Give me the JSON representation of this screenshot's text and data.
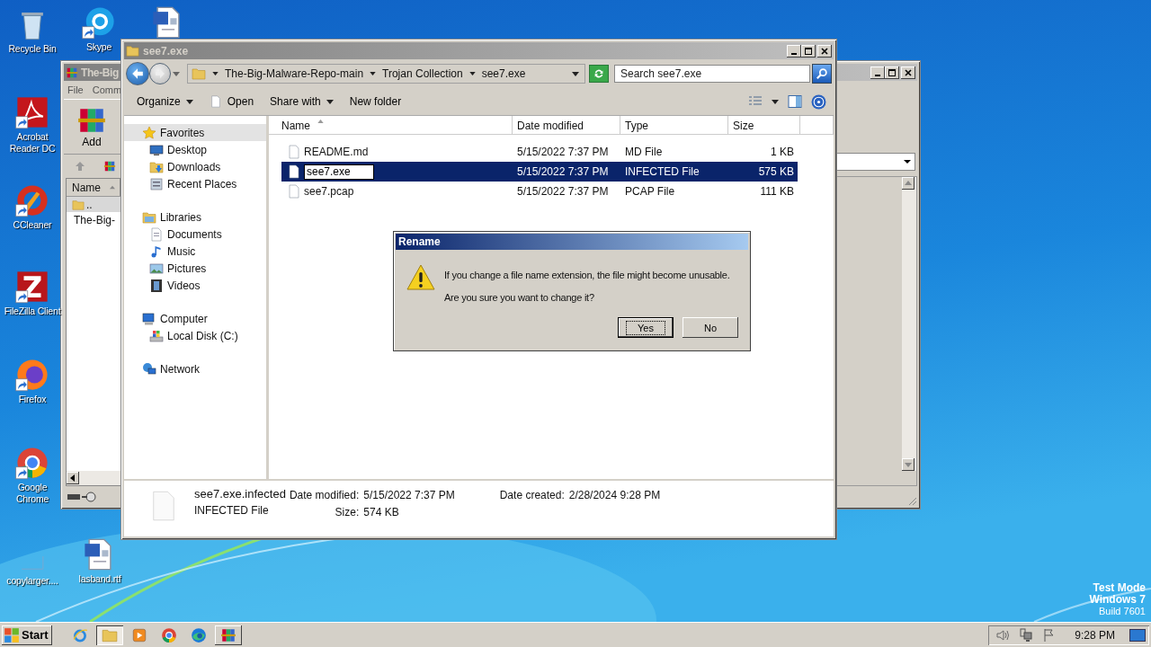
{
  "desktop_icons": [
    {
      "kind": "recycle",
      "label": "Recycle Bin",
      "shortcut": false
    },
    {
      "kind": "skype",
      "label": "Skype",
      "shortcut": true
    },
    {
      "kind": "word",
      "shortcut": false
    },
    {
      "kind": "acrobat",
      "label": "Acrobat Reader DC",
      "shortcut": true
    },
    {
      "kind": "ccleaner",
      "label": "CCleaner",
      "shortcut": true
    },
    {
      "kind": "filezilla",
      "label": "FileZilla Client",
      "shortcut": true
    },
    {
      "kind": "firefox",
      "label": "Firefox",
      "shortcut": true
    },
    {
      "kind": "chrome",
      "label": "Google Chrome",
      "shortcut": true
    },
    {
      "kind": "blank",
      "label": "copylarger....",
      "shortcut": false
    },
    {
      "kind": "word",
      "label": "lasband.rtf",
      "shortcut": false
    }
  ],
  "back_window": {
    "title": "The-Big",
    "menu": [
      "File",
      "Comm"
    ],
    "toolbar": [
      "Add"
    ],
    "column": {
      "label": "Name",
      "sorted": true
    },
    "rows": [
      "..",
      "The-Big-"
    ]
  },
  "explorer": {
    "title": "see7.exe",
    "breadcrumb": [
      "The-Big-Malware-Repo-main",
      "Trojan Collection",
      "see7.exe"
    ],
    "search": {
      "placeholder": "Search see7.exe"
    },
    "toolbar": [
      {
        "label": "Organize",
        "kind": "menu"
      },
      {
        "label": "Open",
        "kind": "file"
      },
      {
        "label": "Share with",
        "kind": "menu"
      },
      {
        "label": "New folder",
        "kind": "plain"
      }
    ],
    "nav": [
      {
        "label": "Favorites",
        "kind": "star",
        "selected": true,
        "children": [
          {
            "label": "Desktop",
            "kind": "desktop",
            "selected": false
          },
          {
            "label": "Downloads",
            "kind": "downloads",
            "selected": false
          },
          {
            "label": "Recent Places",
            "kind": "recent",
            "selected": false
          }
        ]
      },
      {
        "label": "Libraries",
        "kind": "library",
        "selected": false,
        "children": [
          {
            "label": "Documents",
            "kind": "documents",
            "selected": false
          },
          {
            "label": "Music",
            "kind": "music",
            "selected": false
          },
          {
            "label": "Pictures",
            "kind": "pictures",
            "selected": false
          },
          {
            "label": "Videos",
            "kind": "videos",
            "selected": false
          }
        ]
      },
      {
        "label": "Computer",
        "kind": "computer",
        "selected": false,
        "children": [
          {
            "label": "Local Disk (C:)",
            "kind": "disk",
            "selected": false
          }
        ]
      },
      {
        "label": "Network",
        "kind": "network",
        "selected": false
      }
    ],
    "columns": [
      {
        "label": "Name",
        "sorted": true
      },
      {
        "label": "Date modified",
        "sorted": false
      },
      {
        "label": "Type",
        "sorted": false
      },
      {
        "label": "Size",
        "sorted": false
      }
    ],
    "files": [
      {
        "name": "README.md",
        "date": "5/15/2022 7:37 PM",
        "type": "MD File",
        "size": "1 KB",
        "selected": false,
        "renaming": false
      },
      {
        "name": "see7.exe",
        "date": "5/15/2022 7:37 PM",
        "type": "INFECTED File",
        "size": "575 KB",
        "selected": true,
        "renaming": true
      },
      {
        "name": "see7.pcap",
        "date": "5/15/2022 7:37 PM",
        "type": "PCAP File",
        "size": "111 KB",
        "selected": false,
        "renaming": false
      }
    ],
    "details": {
      "name": "see7.exe.infected",
      "type": "INFECTED File",
      "modified_label": "Date modified:",
      "modified": "5/15/2022 7:37 PM",
      "created_label": "Date created:",
      "created": "2/28/2024 9:28 PM",
      "size_label": "Size:",
      "size": "574 KB"
    }
  },
  "dialog": {
    "title": "Rename",
    "message": "If you change a file name extension, the file might become unusable.",
    "question": "Are you sure you want to change it?",
    "buttons": [
      {
        "label": "Yes",
        "default": true
      },
      {
        "label": "No",
        "default": false
      }
    ]
  },
  "taskbar": {
    "start": "Start",
    "apps": [
      {
        "kind": "ie",
        "selected": false,
        "running": false
      },
      {
        "kind": "folder",
        "selected": true,
        "running": true
      },
      {
        "kind": "media",
        "selected": false,
        "running": false
      },
      {
        "kind": "chrome",
        "selected": false,
        "running": false
      },
      {
        "kind": "edge",
        "selected": false,
        "running": false
      },
      {
        "kind": "winrar",
        "selected": false,
        "running": true
      }
    ],
    "clock": "9:28 PM"
  },
  "os_badge": [
    "Test Mode",
    "Windows 7",
    "Build 7601"
  ]
}
